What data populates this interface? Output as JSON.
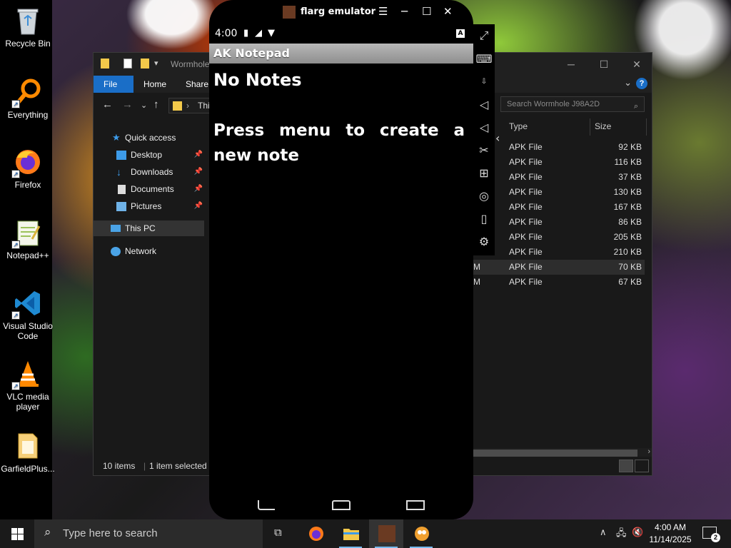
{
  "desktop": {
    "icons": [
      {
        "label": "Recycle Bin"
      },
      {
        "label": "Everything"
      },
      {
        "label": "Firefox"
      },
      {
        "label": "Notepad++"
      },
      {
        "label": "Visual Studio Code"
      },
      {
        "label": "VLC media player"
      },
      {
        "label": "GarfieldPlus..."
      }
    ]
  },
  "explorer": {
    "title": "Wormhole",
    "tabs": {
      "file": "File",
      "home": "Home",
      "share": "Share"
    },
    "help": "?",
    "path": "This",
    "search_placeholder": "Search Wormhole J98A2D",
    "nav": {
      "quick_access": "Quick access",
      "desktop": "Desktop",
      "downloads": "Downloads",
      "documents": "Documents",
      "pictures": "Pictures",
      "this_pc": "This PC",
      "network": "Network"
    },
    "columns": {
      "type": "Type",
      "size": "Size"
    },
    "rows": [
      {
        "lead": "",
        "type": "APK File",
        "size": "92 KB"
      },
      {
        "lead": "",
        "type": "APK File",
        "size": "116 KB"
      },
      {
        "lead": "",
        "type": "APK File",
        "size": "37 KB"
      },
      {
        "lead": "",
        "type": "APK File",
        "size": "130 KB"
      },
      {
        "lead": "",
        "type": "APK File",
        "size": "167 KB"
      },
      {
        "lead": "",
        "type": "APK File",
        "size": "86 KB"
      },
      {
        "lead": "",
        "type": "APK File",
        "size": "205 KB"
      },
      {
        "lead": "M",
        "type": "APK File",
        "size": "210 KB"
      },
      {
        "lead": "M",
        "type": "APK File",
        "size": "70 KB"
      },
      {
        "lead": "M",
        "type": "APK File",
        "size": "67 KB"
      }
    ],
    "status": {
      "items": "10 items",
      "selected": "1 item selected"
    }
  },
  "emulator": {
    "title": "flarg emulator",
    "status_time": "4:00",
    "status_badge": "A",
    "app_title": "AK Notepad",
    "empty_title": "No Notes",
    "empty_hint": "Press menu to create a new note"
  },
  "taskbar": {
    "search_placeholder": "Type here to search",
    "clock_time": "4:00 AM",
    "clock_date": "11/14/2025",
    "notification_count": "2"
  },
  "colors": {
    "accent": "#1a6ec7",
    "folder": "#f3c94a",
    "taskbar": "#1a1a1a",
    "explorer_bg": "#191919"
  }
}
